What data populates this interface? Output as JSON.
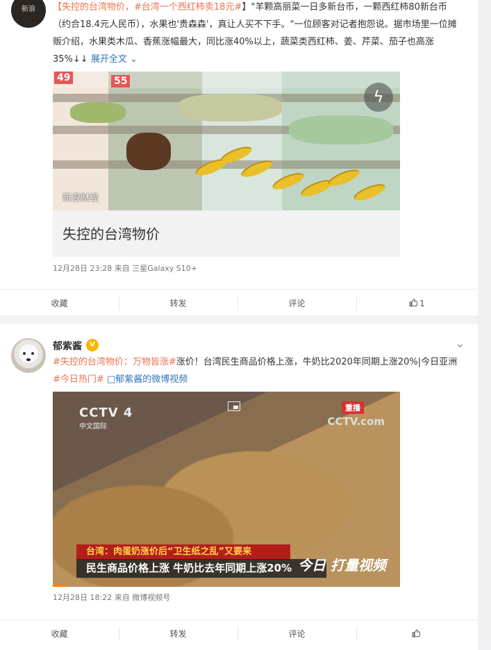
{
  "post1": {
    "avatar_text": "新浪",
    "text_parts": {
      "topic1": "【失控的台湾物价，",
      "topic2": "#台湾一个西红柿卖18元#",
      "body1": "】\"羊颗高丽菜一日多新台币，一颗西红柿80新台币（约合18.4元人民币），水果也'贵森森'，真让人买不下手。\"一位顾客对记者抱怨说。据市场里一位摊贩介绍，水果类木瓜、香蕉涨幅最大，同比涨40%以上，蔬菜类西红柿、姜、芹菜、茄子也高涨35%↓↓ ",
      "expand": "展开全文"
    },
    "image_watermark": "新浪财经",
    "price_tags": [
      "49",
      "55"
    ],
    "caption": "失控的台湾物价",
    "time": "12月28日 23:28",
    "source_prefix": "来自",
    "source": "三星Galaxy S10+",
    "actions": {
      "collect": "收藏",
      "repost": "转发",
      "comment": "评论",
      "like": "1"
    }
  },
  "post2": {
    "name": "郁紫酱",
    "text_parts": {
      "topic": "#失控的台湾物价：万物皆涨#",
      "body": "涨价！台湾民生商品价格上涨，牛奶比2020年同期上涨20%|今日亚洲",
      "topic2": "#今日热门#",
      "link": "□郁紫酱的微博视频"
    },
    "video": {
      "logo_left": "CCTV 4",
      "logo_left_sub": "中文国际",
      "live_badge": "重播",
      "logo_right": "CCTV.com",
      "headline1": "台湾：肉蛋奶涨价后“卫生纸之乱”又要来",
      "headline2": "民生商品价格上涨  牛奶比去年同期上涨20%",
      "show_title": "今日 打量视频"
    },
    "time": "12月28日 18:22",
    "source_prefix": "来自",
    "source": "微博视频号",
    "actions": {
      "collect": "收藏",
      "repost": "转发",
      "comment": "评论",
      "like": ""
    }
  },
  "colors": {
    "topic": "#eb7350",
    "link": "#3374b6",
    "background": "#f2f2f5"
  }
}
